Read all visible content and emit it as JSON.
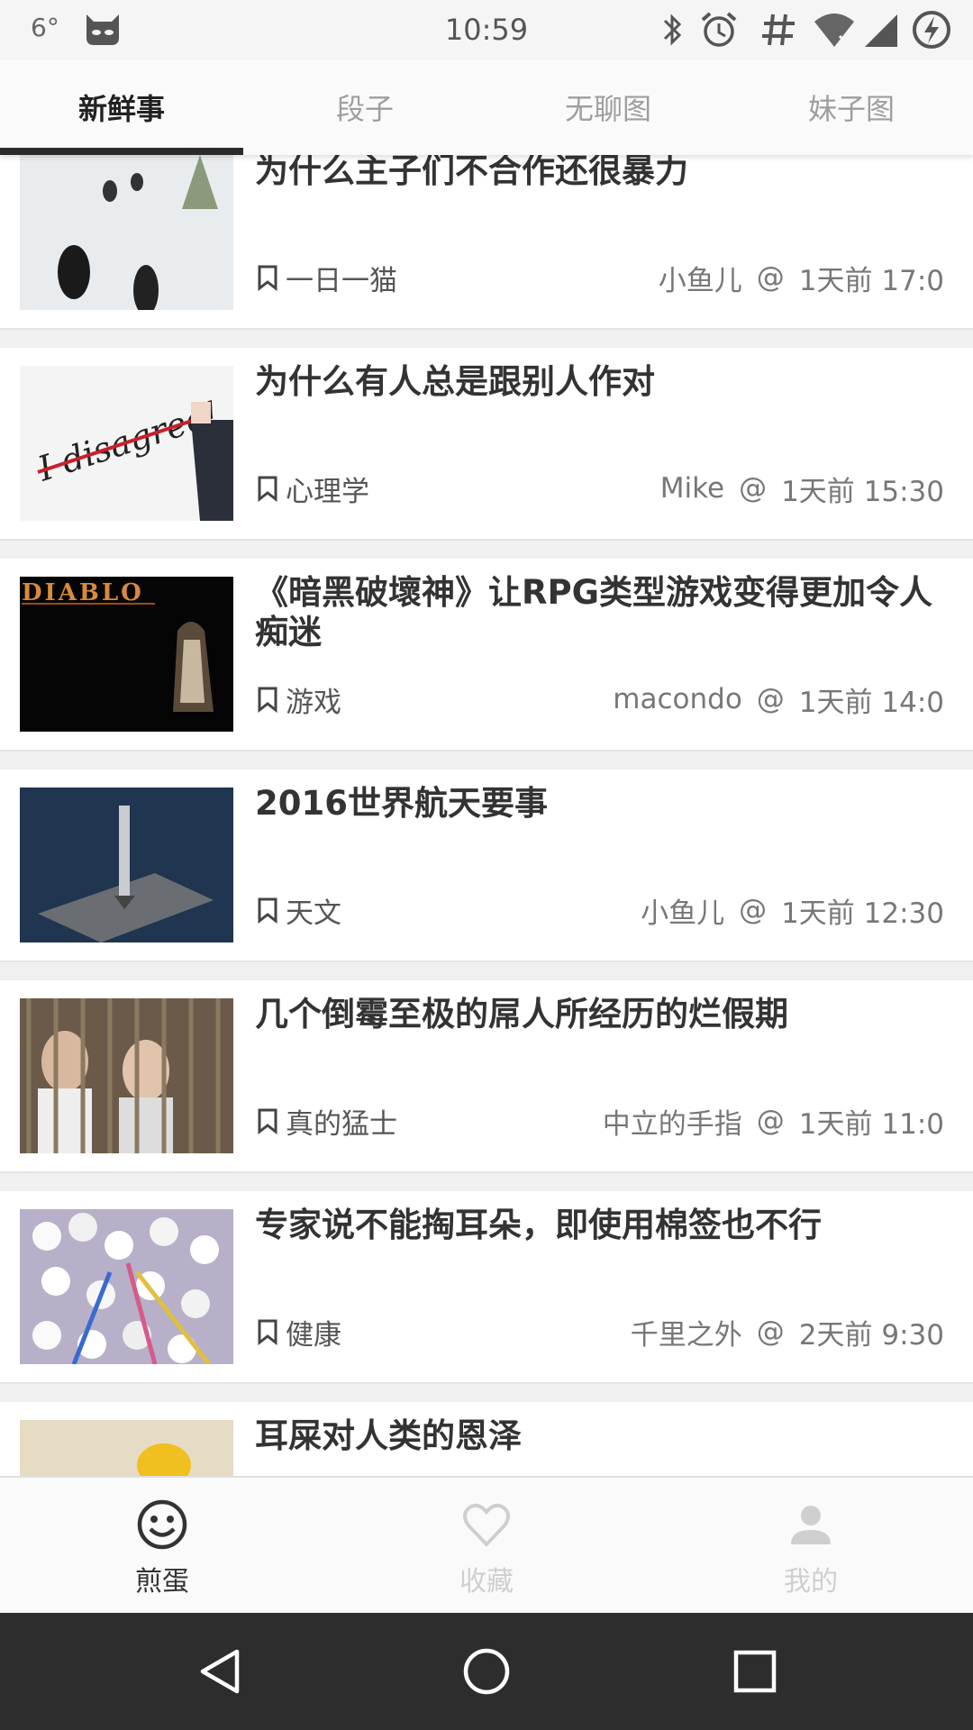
{
  "status_bar": {
    "temperature": "6°",
    "time": "10:59",
    "icons": [
      "cat-face-icon",
      "bluetooth-icon",
      "alarm-icon",
      "hash-icon",
      "wifi-icon",
      "cell-signal-icon",
      "battery-charging-icon"
    ]
  },
  "tabs": [
    {
      "label": "新鲜事",
      "active": true
    },
    {
      "label": "段子",
      "active": false
    },
    {
      "label": "无聊图",
      "active": false
    },
    {
      "label": "妹子图",
      "active": false
    }
  ],
  "feed": [
    {
      "title": "为什么主子们不合作还很暴力",
      "tag": "一日一猫",
      "author": "小鱼儿",
      "at": "@",
      "time": "1天前  17:0",
      "thumb": "cats-in-snow"
    },
    {
      "title": "为什么有人总是跟别人作对",
      "tag": "心理学",
      "author": "Mike",
      "at": "@",
      "time": "1天前  15:30",
      "thumb": "i-disagree"
    },
    {
      "title": "《暗黑破壞神》让RPG类型游戏变得更加令人痴迷",
      "tag": "游戏",
      "author": "macondo",
      "at": "@",
      "time": "1天前  14:0",
      "thumb": "diablo"
    },
    {
      "title": "2016世界航天要事",
      "tag": "天文",
      "author": "小鱼儿",
      "at": "@",
      "time": "1天前  12:30",
      "thumb": "rocket-barge"
    },
    {
      "title": "几个倒霉至极的屌人所经历的烂假期",
      "tag": "真的猛士",
      "author": "中立的手指",
      "at": "@",
      "time": "1天前  11:0",
      "thumb": "people-in-cage"
    },
    {
      "title": "专家说不能掏耳朵，即使用棉签也不行",
      "tag": "健康",
      "author": "千里之外",
      "at": "@",
      "time": "2天前  9:30",
      "thumb": "cotton-swabs"
    },
    {
      "title": "耳屎对人类的恩泽",
      "tag": "",
      "author": "",
      "at": "",
      "time": "",
      "thumb": "partial"
    }
  ],
  "bottom_nav": [
    {
      "label": "煎蛋",
      "icon": "smiley-icon",
      "active": true
    },
    {
      "label": "收藏",
      "icon": "heart-icon",
      "active": false
    },
    {
      "label": "我的",
      "icon": "person-icon",
      "active": false
    }
  ],
  "system_nav": [
    "back-icon",
    "home-icon",
    "recents-icon"
  ],
  "colors": {
    "accent": "#2b2b2b",
    "inactive_tab": "#9e9e9e",
    "inactive_nav": "#cfcfcf",
    "system_bar": "#2d2d2d"
  }
}
